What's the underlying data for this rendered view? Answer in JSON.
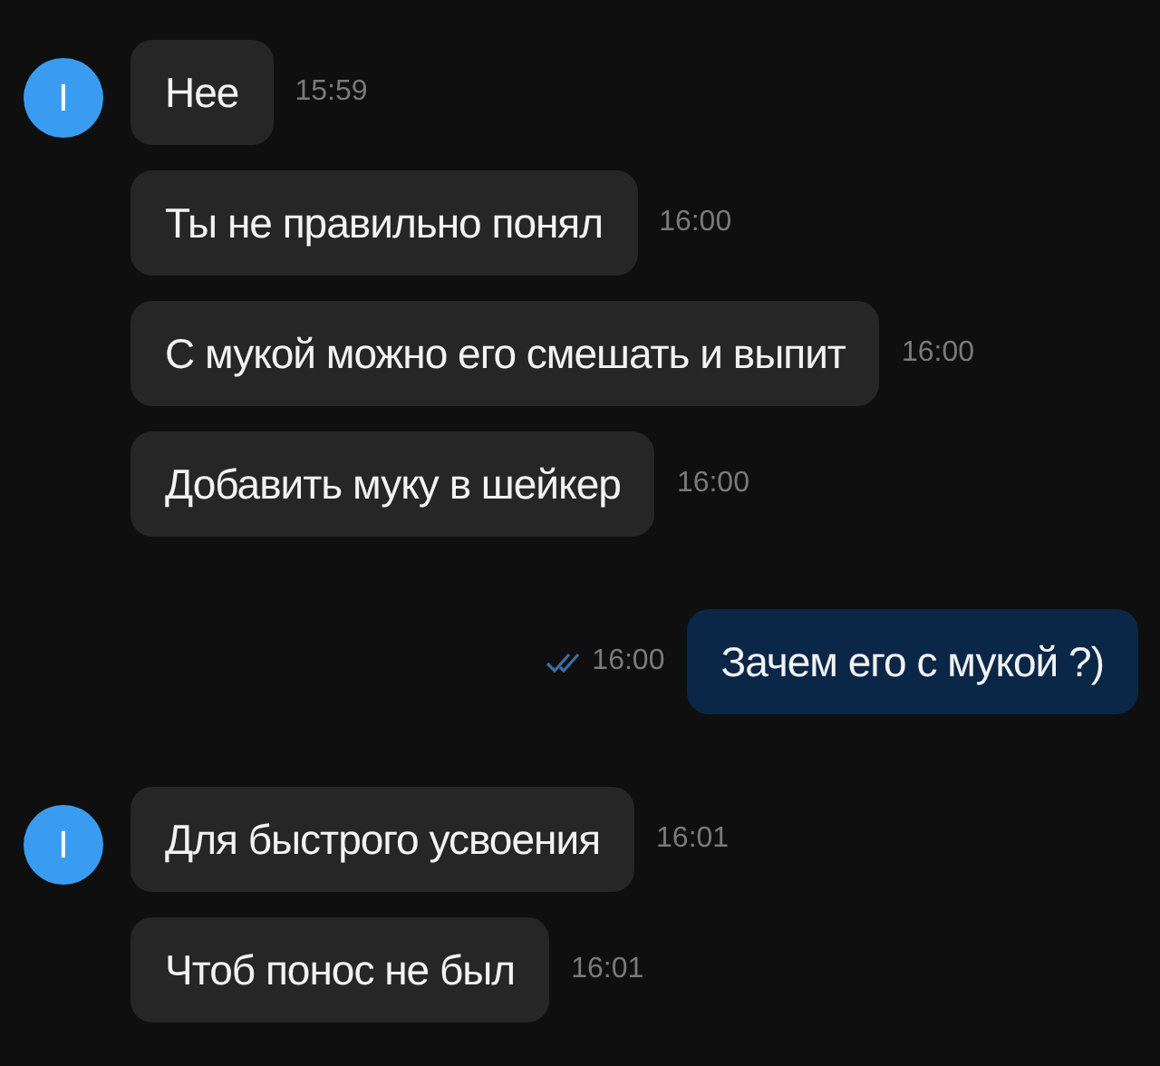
{
  "groups": [
    {
      "kind": "incoming",
      "avatar": "I",
      "messages": [
        {
          "text": "Нее",
          "time": "15:59"
        },
        {
          "text": "Ты не правильно понял",
          "time": "16:00"
        },
        {
          "text": "С мукой можно его смешать и выпит",
          "time": "16:00"
        },
        {
          "text": "Добавить муку в шейкер",
          "time": "16:00"
        }
      ]
    },
    {
      "kind": "outgoing",
      "messages": [
        {
          "text": "Зачем его с мукой ?)",
          "time": "16:00",
          "read": true
        }
      ]
    },
    {
      "kind": "incoming",
      "avatar": "I",
      "messages": [
        {
          "text": "Для быстрого усвоения",
          "time": "16:01"
        },
        {
          "text": "Чтоб понос не был",
          "time": "16:01"
        }
      ]
    }
  ]
}
